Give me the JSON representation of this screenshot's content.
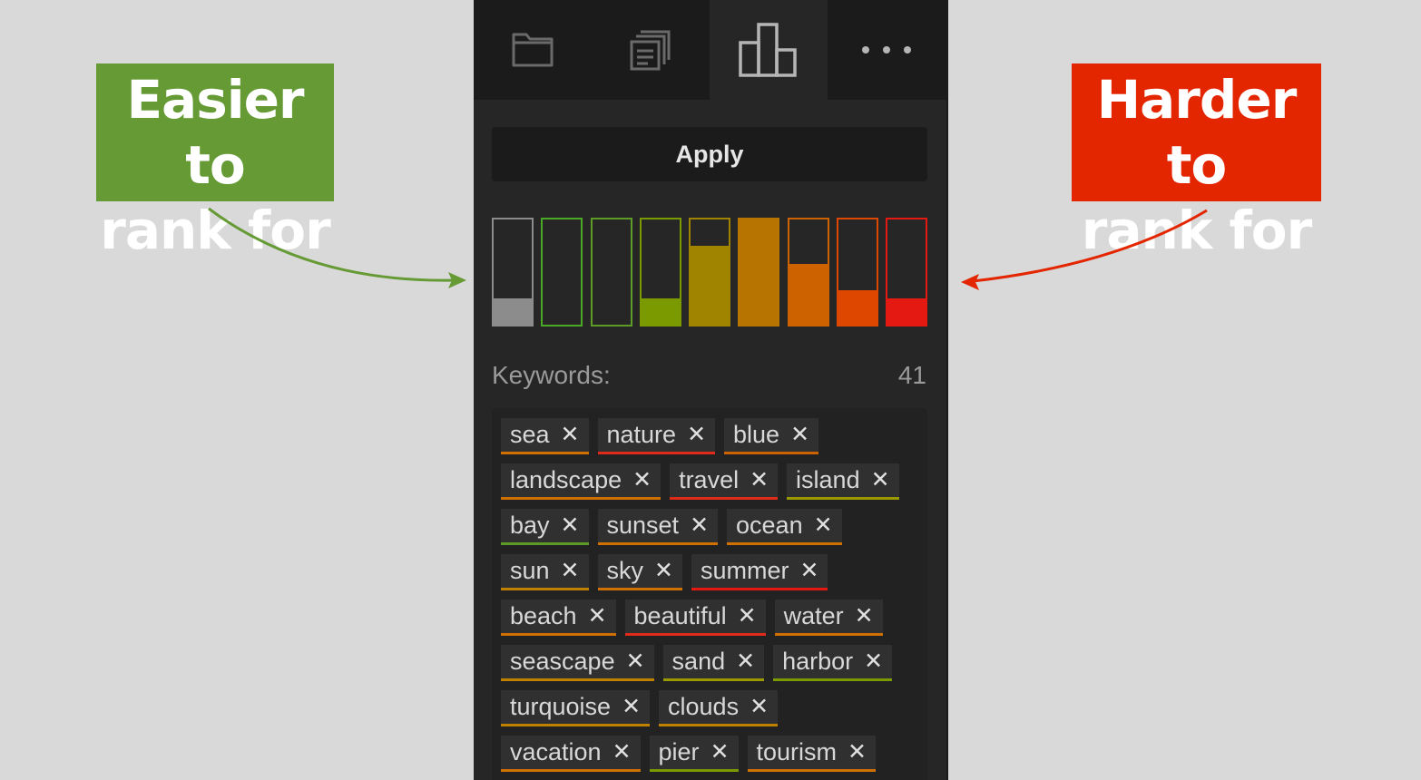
{
  "callouts": {
    "easy": {
      "line1": "Easier to",
      "line2": "rank for",
      "color": "#659a35"
    },
    "hard": {
      "line1": "Harder to",
      "line2": "rank for",
      "color": "#e32500"
    }
  },
  "tabs": [
    {
      "icon": "folder-icon",
      "active": false
    },
    {
      "icon": "documents-icon",
      "active": false
    },
    {
      "icon": "bar-chart-icon",
      "active": true
    },
    {
      "icon": "more-icon",
      "active": false
    }
  ],
  "apply_label": "Apply",
  "difficulty_levels": [
    {
      "level": 1,
      "fill": 0.25,
      "color": "#8c8c8c",
      "border": "#8c8c8c"
    },
    {
      "level": 2,
      "fill": 0.0,
      "color": "#4aa826",
      "border": "#4aa826"
    },
    {
      "level": 3,
      "fill": 0.0,
      "color": "#5d9b26",
      "border": "#5d9b26"
    },
    {
      "level": 4,
      "fill": 0.25,
      "color": "#7a9a00",
      "border": "#7a9a00"
    },
    {
      "level": 5,
      "fill": 0.75,
      "color": "#a08400",
      "border": "#a08400"
    },
    {
      "level": 6,
      "fill": 1.0,
      "color": "#b87400",
      "border": "#b87400"
    },
    {
      "level": 7,
      "fill": 0.58,
      "color": "#cc6200",
      "border": "#cc6200"
    },
    {
      "level": 8,
      "fill": 0.33,
      "color": "#dd4700",
      "border": "#dd4700"
    },
    {
      "level": 9,
      "fill": 0.25,
      "color": "#e41a12",
      "border": "#e41a12"
    }
  ],
  "keywords": {
    "label": "Keywords:",
    "count": "41",
    "remove_symbol": "✕",
    "items": [
      {
        "text": "sea",
        "color": "#d07000"
      },
      {
        "text": "nature",
        "color": "#e02a1a"
      },
      {
        "text": "blue",
        "color": "#cc6200"
      },
      {
        "text": "landscape",
        "color": "#d07000"
      },
      {
        "text": "travel",
        "color": "#e02a1a"
      },
      {
        "text": "island",
        "color": "#9a9a00"
      },
      {
        "text": "bay",
        "color": "#5d9b26"
      },
      {
        "text": "sunset",
        "color": "#d07000"
      },
      {
        "text": "ocean",
        "color": "#d07000"
      },
      {
        "text": "sun",
        "color": "#c08000"
      },
      {
        "text": "sky",
        "color": "#d07000"
      },
      {
        "text": "summer",
        "color": "#e41a12"
      },
      {
        "text": "beach",
        "color": "#d07000"
      },
      {
        "text": "beautiful",
        "color": "#e02a1a"
      },
      {
        "text": "water",
        "color": "#d07000"
      },
      {
        "text": "seascape",
        "color": "#c08000"
      },
      {
        "text": "sand",
        "color": "#9a9a00"
      },
      {
        "text": "harbor",
        "color": "#7a9a00"
      },
      {
        "text": "turquoise",
        "color": "#c08000"
      },
      {
        "text": "clouds",
        "color": "#c08000"
      },
      {
        "text": "vacation",
        "color": "#d07000"
      },
      {
        "text": "pier",
        "color": "#7a9a00"
      },
      {
        "text": "tourism",
        "color": "#d07000"
      }
    ]
  }
}
